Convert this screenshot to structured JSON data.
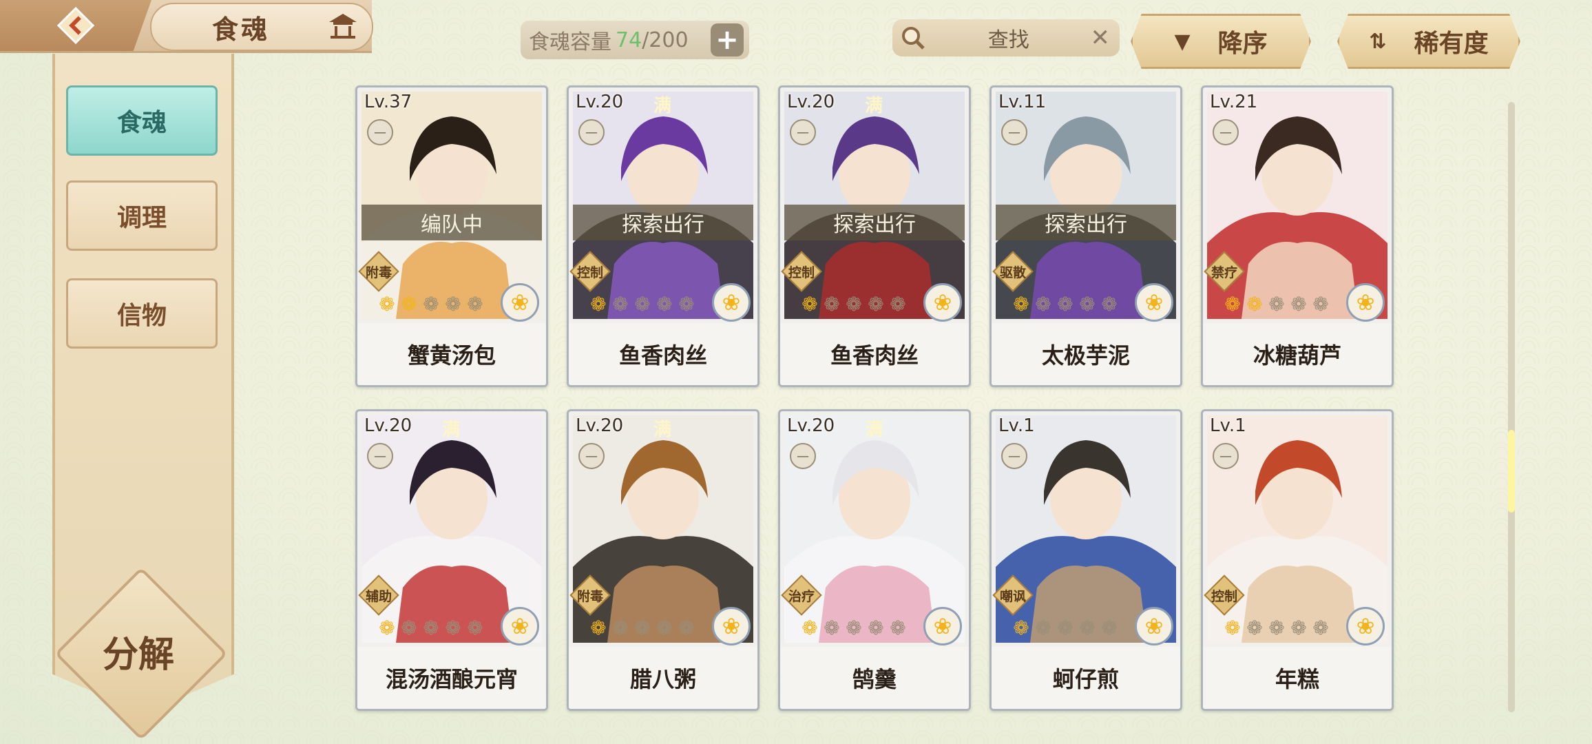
{
  "header": {
    "title": "食魂",
    "capacity_label": "食魂容量",
    "capacity_current": "74",
    "capacity_max": "/200",
    "capacity_add": "+",
    "search_text": "查找",
    "search_clear": "✕",
    "sort_order_label": "降序",
    "sort_key_label": "稀有度"
  },
  "sidebar": {
    "tabs": [
      {
        "label": "食魂",
        "active": true
      },
      {
        "label": "调理",
        "active": false
      },
      {
        "label": "信物",
        "active": false
      }
    ],
    "decompose_label": "分解"
  },
  "cards": [
    {
      "level": "Lv.37",
      "full": "",
      "status": "编队中",
      "role": "附毒",
      "stars": 2,
      "name": "蟹黄汤包"
    },
    {
      "level": "Lv.20",
      "full": "满",
      "status": "探索出行",
      "role": "控制",
      "stars": 1,
      "name": "鱼香肉丝"
    },
    {
      "level": "Lv.20",
      "full": "满",
      "status": "探索出行",
      "role": "控制",
      "stars": 1,
      "name": "鱼香肉丝"
    },
    {
      "level": "Lv.11",
      "full": "",
      "status": "探索出行",
      "role": "驱散",
      "stars": 1,
      "name": "太极芋泥"
    },
    {
      "level": "Lv.21",
      "full": "",
      "status": "",
      "role": "禁疗",
      "stars": 2,
      "name": "冰糖葫芦"
    },
    {
      "level": "Lv.20",
      "full": "满",
      "status": "",
      "role": "辅助",
      "stars": 1,
      "name": "混汤酒酿元宵"
    },
    {
      "level": "Lv.20",
      "full": "满",
      "status": "",
      "role": "附毒",
      "stars": 1,
      "name": "腊八粥"
    },
    {
      "level": "Lv.20",
      "full": "满",
      "status": "",
      "role": "治疗",
      "stars": 1,
      "name": "鹄羹"
    },
    {
      "level": "Lv.1",
      "full": "",
      "status": "",
      "role": "嘲讽",
      "stars": 1,
      "name": "蚵仔煎"
    },
    {
      "level": "Lv.1",
      "full": "",
      "status": "",
      "role": "控制",
      "stars": 1,
      "name": "年糕"
    }
  ],
  "icons": {
    "back": "back-arrow-icon",
    "pavilion": "pavilion-icon",
    "search": "search-icon",
    "lock": "lock-icon",
    "flower": "flower-icon",
    "star": "flame-star-icon"
  }
}
